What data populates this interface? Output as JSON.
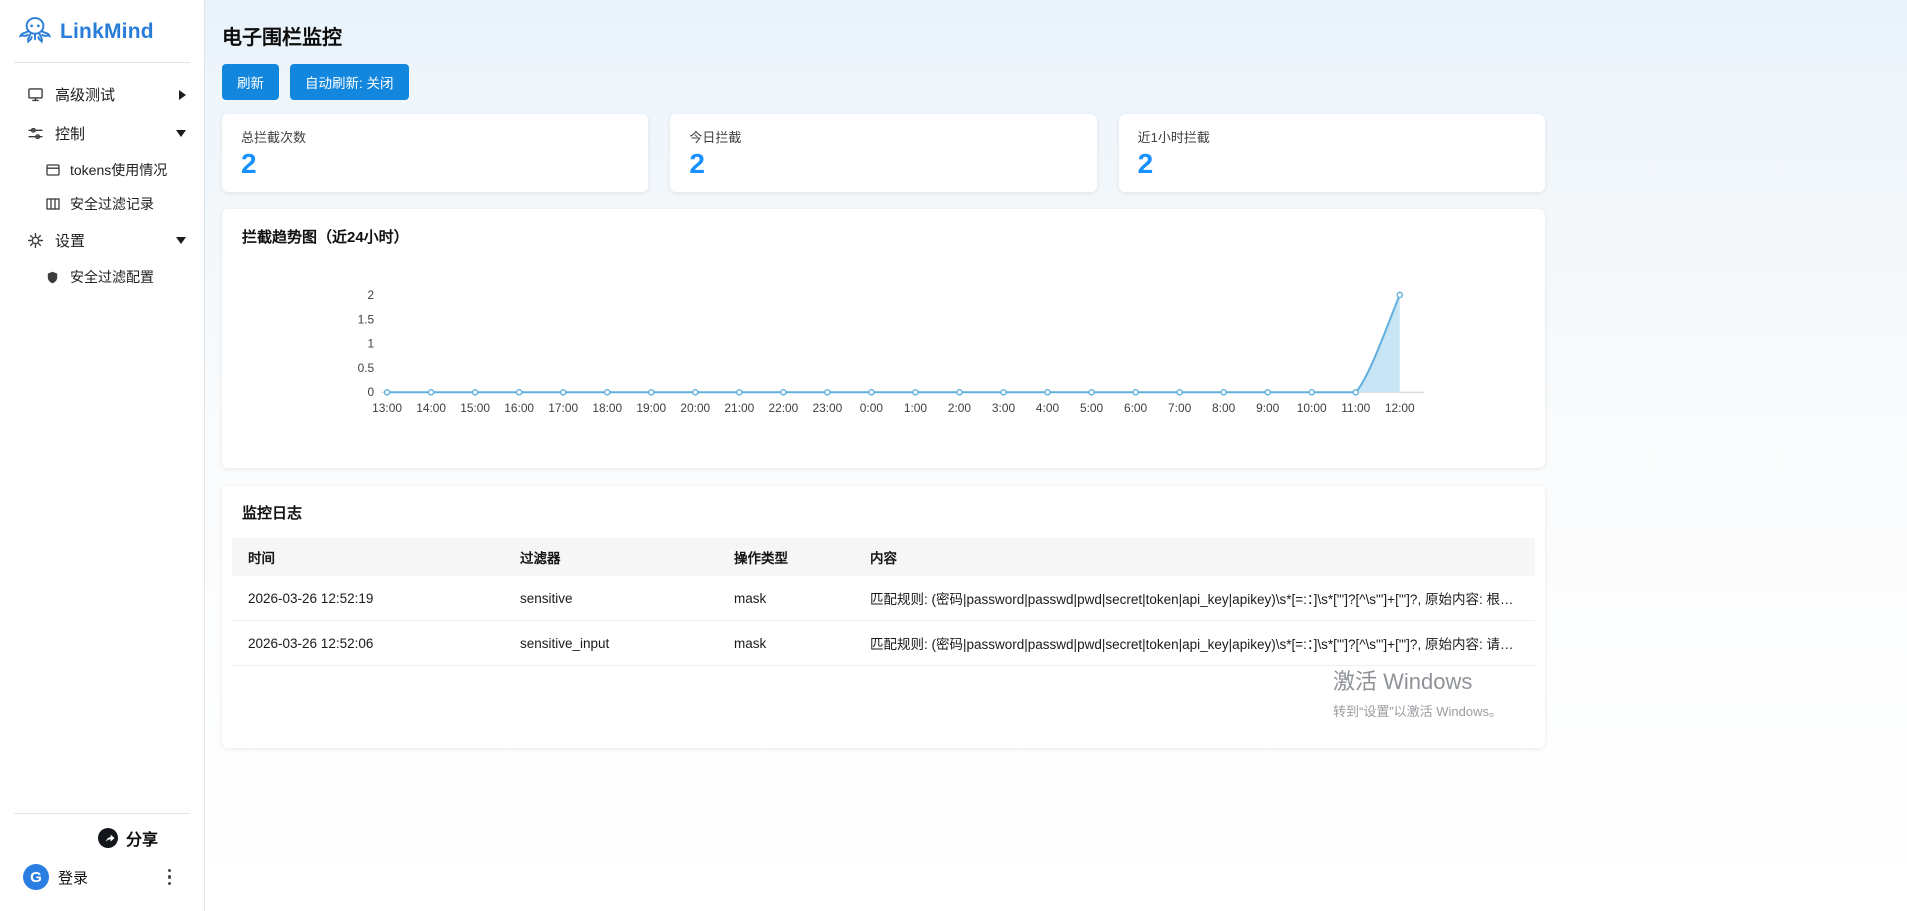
{
  "colors": {
    "accent": "#1890ff",
    "button": "#1287dd",
    "chart_line": "#5fb0dd",
    "chart_fill": "#c2e2f5",
    "logo": "#2a7cd9"
  },
  "sidebar": {
    "logo_text": "LinkMind",
    "items": [
      {
        "label": "高级测试"
      },
      {
        "label": "控制",
        "children": [
          {
            "label": "tokens使用情况"
          },
          {
            "label": "安全过滤记录"
          }
        ]
      },
      {
        "label": "设置",
        "children": [
          {
            "label": "安全过滤配置"
          }
        ]
      }
    ],
    "share_label": "分享",
    "login_label": "登录",
    "login_icon_glyph": "G"
  },
  "header": {
    "title": "电子围栏监控",
    "refresh_label": "刷新",
    "auto_refresh_label": "自动刷新: 关闭"
  },
  "stats": [
    {
      "label": "总拦截次数",
      "value": "2"
    },
    {
      "label": "今日拦截",
      "value": "2"
    },
    {
      "label": "近1小时拦截",
      "value": "2"
    }
  ],
  "chart_section": {
    "title": "拦截趋势图（近24小时）"
  },
  "chart_data": {
    "type": "line",
    "title": "拦截趋势图（近24小时）",
    "x": [
      "13:00",
      "14:00",
      "15:00",
      "16:00",
      "17:00",
      "18:00",
      "19:00",
      "20:00",
      "21:00",
      "22:00",
      "23:00",
      "0:00",
      "1:00",
      "2:00",
      "3:00",
      "4:00",
      "5:00",
      "6:00",
      "7:00",
      "8:00",
      "9:00",
      "10:00",
      "11:00",
      "12:00"
    ],
    "values": [
      0,
      0,
      0,
      0,
      0,
      0,
      0,
      0,
      0,
      0,
      0,
      0,
      0,
      0,
      0,
      0,
      0,
      0,
      0,
      0,
      0,
      0,
      0,
      2
    ],
    "ylim": [
      0,
      2
    ],
    "yticks": [
      0,
      0.5,
      1,
      1.5,
      2
    ],
    "xlabel": "",
    "ylabel": "",
    "grid": false,
    "smooth": true,
    "area": true,
    "legend": "none"
  },
  "logs": {
    "title": "监控日志",
    "columns": [
      "时间",
      "过滤器",
      "操作类型",
      "内容"
    ],
    "rows": [
      {
        "time": "2026-03-26 12:52:19",
        "filter": "sensitive",
        "action": "mask",
        "content": "匹配规则: (密码|password|passwd|pwd|secret|token|api_key|apikey)\\s*[=:：]\\s*[\"']?[^\\s\"']+[\"']?, 原始内容: 根据您提供的文..."
      },
      {
        "time": "2026-03-26 12:52:06",
        "filter": "sensitive_input",
        "action": "mask",
        "content": "匹配规则: (密码|password|passwd|pwd|secret|token|api_key|apikey)\\s*[=:：]\\s*[\"']?[^\\s\"']+[\"']?, 原始内容: 请帮我拆分结构..."
      }
    ]
  },
  "watermark": {
    "line1": "激活 Windows",
    "line2": "转到“设置”以激活 Windows。"
  }
}
